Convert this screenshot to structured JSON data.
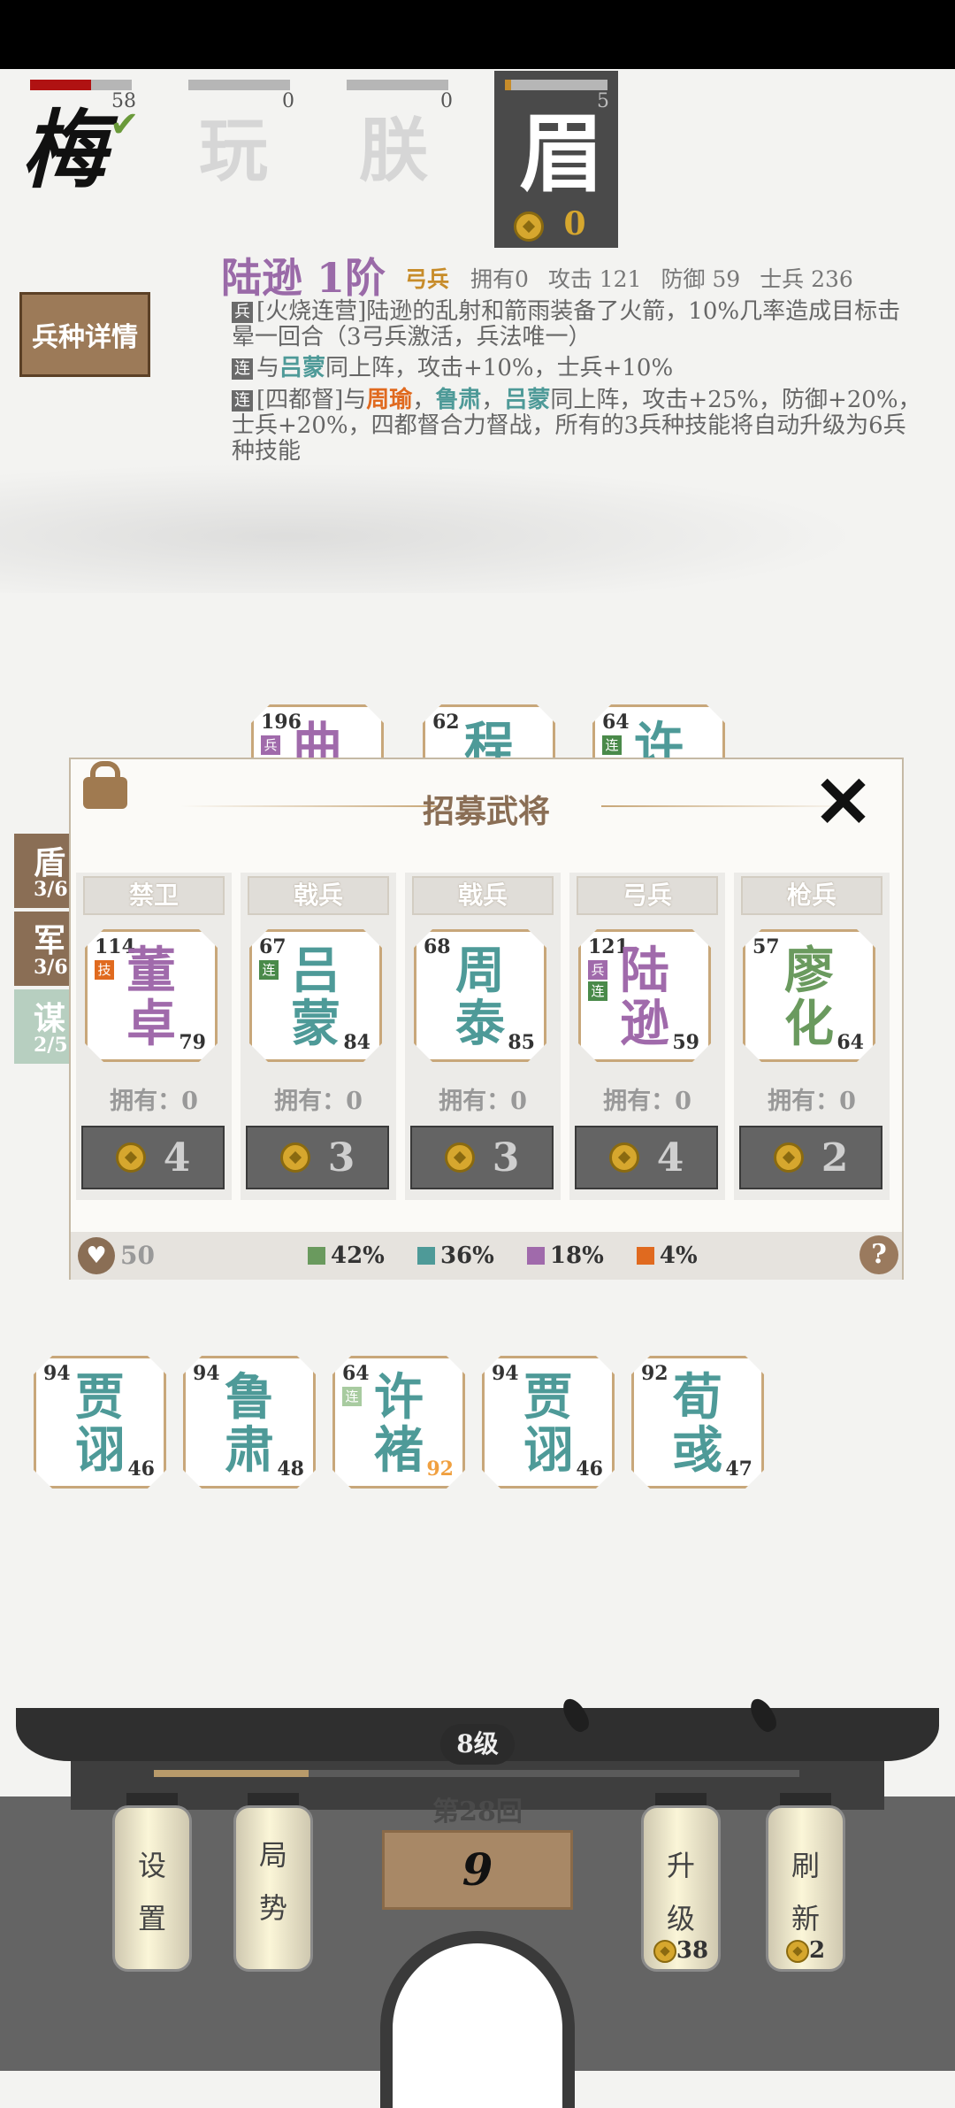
{
  "players": [
    {
      "glyph": "梅",
      "score": "58",
      "hp_fraction": 0.6,
      "check": "✔"
    },
    {
      "glyph": "玩",
      "score": "0",
      "hp_fraction": 0
    },
    {
      "glyph": "朕",
      "score": "0",
      "hp_fraction": 0
    },
    {
      "glyph": "眉",
      "score": "5",
      "hp_fraction": 0.06,
      "gold": "0"
    }
  ],
  "general": {
    "name": "陆逊 1阶",
    "type": "弓兵",
    "owned": "拥有0",
    "attack": "攻击 121",
    "defense": "防御 59",
    "soldiers": "士兵 236",
    "detail_button": "兵种详情",
    "skills": [
      {
        "tag": "兵",
        "text": "[火烧连营]陆逊的乱射和箭雨装备了火箭，10%几率造成目标击晕一回合（3弓兵激活，兵法唯一）"
      },
      {
        "tag": "连",
        "pre": "与",
        "hl1": "吕蒙",
        "post": "同上阵，攻击+10%，士兵+10%"
      },
      {
        "tag": "连",
        "pre": "[四都督]与",
        "hl1": "周瑜",
        "sep1": "，",
        "hl2": "鲁肃",
        "sep2": "，",
        "hl3": "吕蒙",
        "post": "同上阵，攻击+25%，防御+20%，士兵+20%，四都督合力督战，所有的3兵种技能将自动升级为6兵种技能"
      }
    ]
  },
  "board_top": [
    {
      "num": "196",
      "badge": "兵",
      "n1": "曲"
    },
    {
      "num": "62",
      "n1": "程"
    },
    {
      "num": "64",
      "badge": "连",
      "n1": "许"
    }
  ],
  "side_tabs": [
    {
      "title": "盾",
      "count": "3/6"
    },
    {
      "title": "军",
      "count": "3/6"
    },
    {
      "title": "谋",
      "count": "2/5"
    }
  ],
  "recruit": {
    "title": "招募武将",
    "close": "✕",
    "slots": [
      {
        "type": "禁卫",
        "atk": "114",
        "badges": [
          "技"
        ],
        "n1": "董",
        "n2": "卓",
        "def": "79",
        "own": "拥有：0",
        "cost": "4",
        "color": "#a06aab"
      },
      {
        "type": "戟兵",
        "atk": "67",
        "badges": [
          "连"
        ],
        "n1": "吕",
        "n2": "蒙",
        "def": "84",
        "own": "拥有：0",
        "cost": "3",
        "color": "#4e9a98"
      },
      {
        "type": "戟兵",
        "atk": "68",
        "badges": [],
        "n1": "周",
        "n2": "泰",
        "def": "85",
        "own": "拥有：0",
        "cost": "3",
        "color": "#4e9a98"
      },
      {
        "type": "弓兵",
        "atk": "121",
        "badges": [
          "兵",
          "连"
        ],
        "n1": "陆",
        "n2": "逊",
        "def": "59",
        "own": "拥有：0",
        "cost": "4",
        "color": "#a06aab",
        "selected": true
      },
      {
        "type": "枪兵",
        "atk": "57",
        "badges": [],
        "n1": "廖",
        "n2": "化",
        "def": "64",
        "own": "拥有：0",
        "cost": "2",
        "color": "#6a9a5e"
      }
    ],
    "refresh_cost": "50",
    "odds": [
      {
        "value": "42%",
        "color": "#6a9a5e"
      },
      {
        "value": "36%",
        "color": "#4e9a98"
      },
      {
        "value": "18%",
        "color": "#a06aab"
      },
      {
        "value": "4%",
        "color": "#e06a1f"
      }
    ],
    "help": "?"
  },
  "bench": [
    {
      "atk": "94",
      "n1": "贾",
      "n2": "诩",
      "def": "46"
    },
    {
      "atk": "94",
      "n1": "鲁",
      "n2": "肃",
      "def": "48"
    },
    {
      "atk": "64",
      "badge": "连",
      "n1": "许",
      "n2": "褚",
      "def": "92"
    },
    {
      "atk": "94",
      "n1": "贾",
      "n2": "诩",
      "def": "46"
    },
    {
      "atk": "92",
      "n1": "荀",
      "n2": "彧",
      "def": "47"
    }
  ],
  "hud": {
    "level": "8级",
    "round": "第28回",
    "progress": 0.24,
    "gold": "9",
    "settings": [
      "设",
      "置"
    ],
    "situation": [
      "局",
      "势"
    ],
    "upgrade": [
      "升",
      "级"
    ],
    "upgrade_cost": "38",
    "refresh": [
      "刷",
      "新"
    ],
    "refresh_cost": "2"
  }
}
